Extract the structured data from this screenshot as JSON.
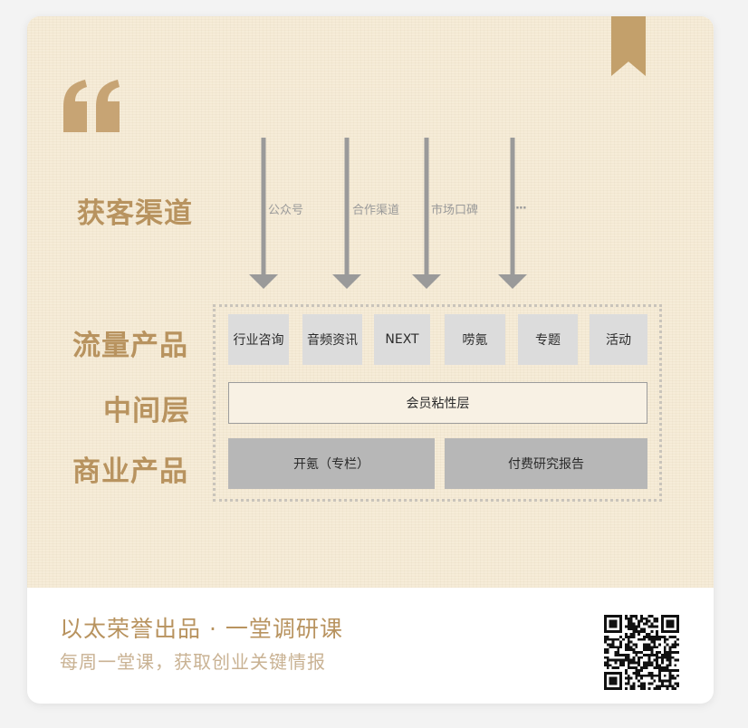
{
  "row_labels": {
    "acquisition": "获客渠道",
    "traffic": "流量产品",
    "middle": "中间层",
    "business": "商业产品"
  },
  "channels": [
    "公众号",
    "合作渠道",
    "市场口碑"
  ],
  "channels_more": "····",
  "traffic_products": [
    "行业咨询",
    "音频资讯",
    "NEXT",
    "唠氪",
    "专题",
    "活动"
  ],
  "middle_layer": "会员粘性层",
  "business_products": [
    "开氪（专栏）",
    "付费研究报告"
  ],
  "footer": {
    "title": "以太荣誉出品 · 一堂调研课",
    "subtitle": "每周一堂课，获取创业关键情报"
  },
  "colors": {
    "accent": "#b8935f",
    "arrow": "#9a9a9a",
    "paper": "#f6ecd8"
  },
  "icons": [
    "bookmark-icon",
    "quote-icon",
    "qr-code-icon"
  ]
}
